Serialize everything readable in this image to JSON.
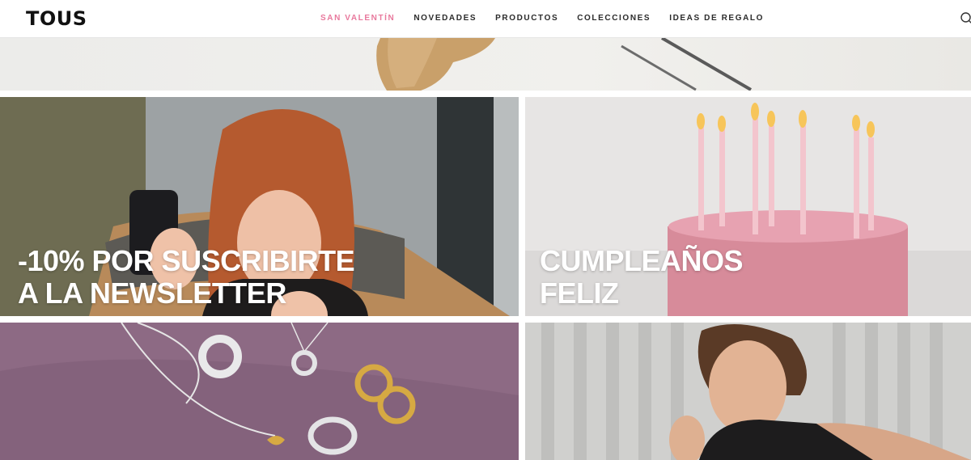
{
  "brand": {
    "name": "TOUS"
  },
  "nav": {
    "items": [
      {
        "label": "SAN VALENTÍN",
        "active": true
      },
      {
        "label": "NOVEDADES",
        "active": false
      },
      {
        "label": "PRODUCTOS",
        "active": false
      },
      {
        "label": "COLECCIONES",
        "active": false
      },
      {
        "label": "IDEAS DE REGALO",
        "active": false
      }
    ],
    "search_icon": "search-icon"
  },
  "tiles": {
    "newsletter": {
      "caption_line1": "-10% POR SUSCRIBIRTE",
      "caption_line2": "A LA NEWSLETTER"
    },
    "birthday": {
      "caption_line1": "CUMPLEAÑOS",
      "caption_line2": "FELIZ"
    }
  },
  "colors": {
    "accent": "#e8799d",
    "text": "#2b2b2b"
  }
}
